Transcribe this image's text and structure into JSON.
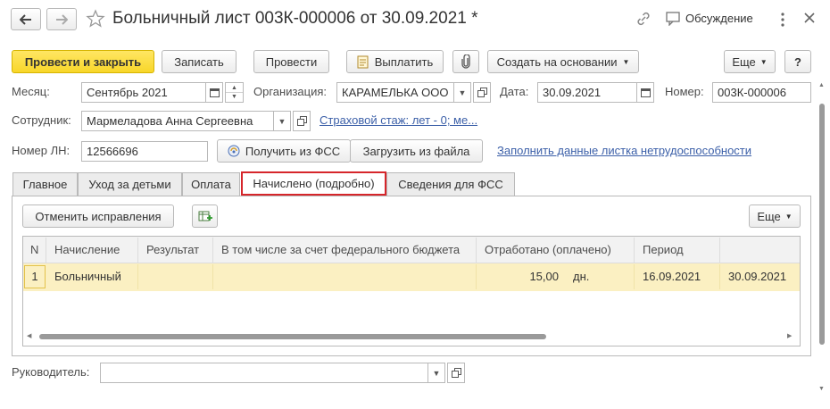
{
  "window": {
    "title": "Больничный лист 003К-000006 от 30.09.2021 *",
    "discussion_label": "Обсуждение"
  },
  "toolbar": {
    "post_and_close": "Провести и закрыть",
    "save": "Записать",
    "post": "Провести",
    "pay": "Выплатить",
    "create_based_on": "Создать на основании",
    "more": "Еще",
    "help": "?"
  },
  "form": {
    "month_label": "Месяц:",
    "month_value": "Сентябрь 2021",
    "org_label": "Организация:",
    "org_value": "КАРАМЕЛЬКА ООО",
    "date_label": "Дата:",
    "date_value": "30.09.2021",
    "number_label": "Номер:",
    "number_value": "003К-000006",
    "employee_label": "Сотрудник:",
    "employee_value": "Мармеладова Анна Сергеевна",
    "insurance_link": "Страховой стаж: лет - 0; ме...",
    "ln_label": "Номер ЛН:",
    "ln_value": "12566696",
    "get_fss": "Получить из ФСС",
    "load_file": "Загрузить из файла",
    "fill_link": "Заполнить данные листка нетрудоспособности"
  },
  "tabs": [
    {
      "label": "Главное"
    },
    {
      "label": "Уход за детьми"
    },
    {
      "label": "Оплата"
    },
    {
      "label": "Начислено (подробно)"
    },
    {
      "label": "Сведения для ФСС"
    }
  ],
  "panel": {
    "cancel_corrections": "Отменить исправления",
    "more": "Еще"
  },
  "table": {
    "headers": [
      "N",
      "Начисление",
      "Результат",
      "В том числе за счет федерального бюджета",
      "Отработано (оплачено)",
      "Период",
      ""
    ],
    "rows": [
      {
        "n": "1",
        "accrual": "Больничный",
        "result": "",
        "federal": "",
        "worked": "15,00",
        "unit": "дн.",
        "period_from": "16.09.2021",
        "period_to": "30.09.2021"
      }
    ]
  },
  "footer": {
    "manager_label": "Руководитель:",
    "manager_value": ""
  },
  "colors": {
    "primary_button": "#f8d629",
    "selected_row": "#fbf0c2",
    "active_tab_border": "#d6262b",
    "link": "#3b5fa8"
  }
}
